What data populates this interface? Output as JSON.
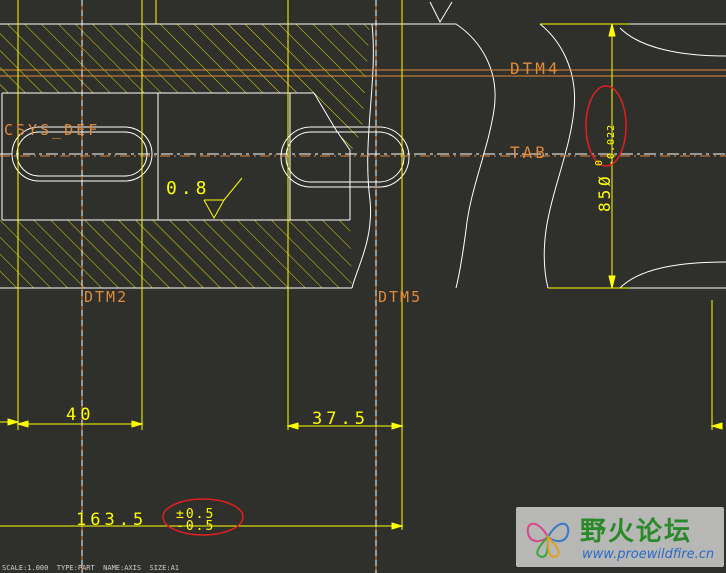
{
  "drawing": {
    "datum_labels": {
      "dtm4": "DTM4",
      "tab": "TAB",
      "csys": "CSYS_DEF",
      "dtm2": "DTM2",
      "dtm5": "DTM5"
    },
    "surface_finish": "0.8",
    "dimensions": {
      "width_40": "40",
      "width_37_5": "37.5",
      "length_163_5": "163.5",
      "length_tolerance_plus": "±0.5",
      "length_tolerance_minus": "-0.5",
      "diameter_85": "85",
      "diameter_tolerance_upper": "0",
      "diameter_tolerance_lower": "-0.022"
    },
    "colors": {
      "background": "#2f2f2b",
      "geometry": "#ffffff",
      "dimension": "#ffff00",
      "hatch": "#e0e000",
      "datum": "#e08a3a",
      "annotation": "#e02020"
    }
  },
  "status_bar": {
    "text": "SCALE:1.000  TYPE:PART  NAME:AXIS  SIZE:A1"
  },
  "watermark": {
    "title": "野火论坛",
    "url": "www.proewildfire.cn"
  }
}
